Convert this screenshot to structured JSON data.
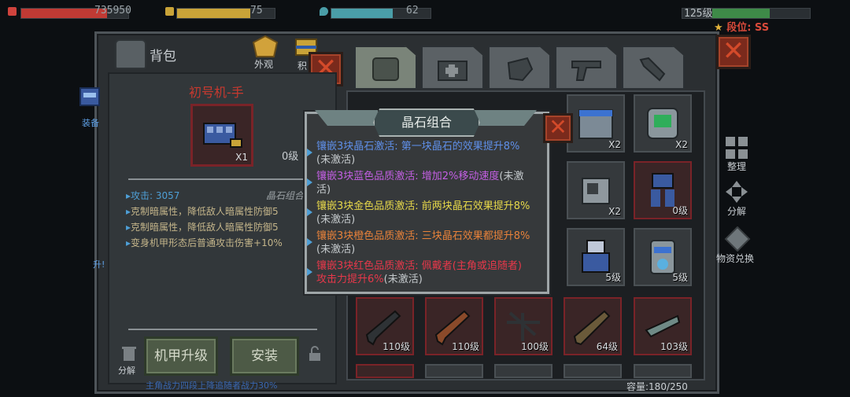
{
  "hud": {
    "hp": {
      "value": "735950",
      "fill": 0.8,
      "color": "#c03a34"
    },
    "energy": {
      "value": "75",
      "fill": 0.75,
      "color": "#c9a338"
    },
    "water": {
      "value": "62",
      "fill": 0.62,
      "color": "#4a9ea8"
    },
    "level": {
      "label": "125级",
      "fill": 0.45,
      "color": "#3e8a48"
    },
    "rank": {
      "label": "段位: SS",
      "color": "#d94a3a"
    }
  },
  "backpack": {
    "title": "背包",
    "appearance_label": "外观",
    "second_label": "积",
    "equip_label": "装备",
    "upgrade_side_label": "升!",
    "mech_name": "初号机-手",
    "mech_count": "X1",
    "mech_level": "0级",
    "stats": [
      "攻击: 3057",
      "克制暗属性，降低敌人暗属性防御5",
      "克制暗属性，降低敌人暗属性防御5",
      "变身机甲形态后普通攻击伤害+10%"
    ],
    "stat_right": "晶石组合",
    "upgrade_button": "机甲升级",
    "install_button": "安装",
    "discard_label": "分解",
    "bottom_text": "主角战力四段上降追随者战力30%"
  },
  "side_menu": {
    "sort": "整理",
    "decompose": "分解",
    "exchange": "物资兑换"
  },
  "inventory": {
    "capacity": "容量:180/250",
    "row1": [
      "",
      "",
      "",
      "X2",
      "X2"
    ],
    "row2": [
      "X2",
      "0级"
    ],
    "row3": [
      "5级",
      "5级"
    ],
    "row4": [
      "110级",
      "110级",
      "100级",
      "64级",
      "103级"
    ]
  },
  "popup": {
    "title": "晶石组合",
    "lines": [
      {
        "text": "镶嵌3块晶石激活: 第一块晶石的效果提升8%",
        "status": "(未激活)",
        "color": "#5f8fe8"
      },
      {
        "text": "镶嵌3块蓝色品质激活: 增加2%移动速度",
        "status": "(未激活)",
        "color": "#c35fe3"
      },
      {
        "text": "镶嵌3块金色品质激活: 前两块晶石效果提升8%",
        "status": "(未激活)",
        "color": "#e7d84a"
      },
      {
        "text": "镶嵌3块橙色品质激活: 三块晶石效果都提升8%",
        "status": "(未激活)",
        "color": "#e8823a"
      },
      {
        "text": "镶嵌3块红色品质激活: 佩戴者(主角或追随者)攻击力提升6%",
        "status": "(未激活)",
        "color": "#e8384a"
      }
    ]
  }
}
